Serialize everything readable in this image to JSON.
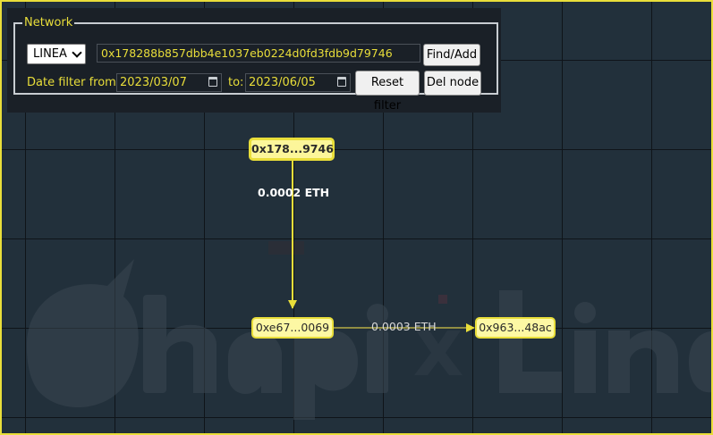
{
  "network": {
    "legend": "Network",
    "chain_selected": "LINEA",
    "address_value": "0x178288b857dbb4e1037eb0224d0fd3fdb9d79746",
    "find_add_label": "Find/Add",
    "date_filter_from_label": "Date filter from:",
    "date_from": "2023/03/07",
    "to_label": "to:",
    "date_to": "2023/06/05",
    "reset_filter_label": "Reset filter",
    "del_node_label": "Del node"
  },
  "graph": {
    "nodes": [
      {
        "id": "root",
        "label": "0x178...9746"
      },
      {
        "id": "mid",
        "label": "0xe67...0069"
      },
      {
        "id": "right",
        "label": "0x963...48ac"
      }
    ],
    "edges": [
      {
        "label": "0.0002 ETH"
      },
      {
        "label": "0.0003 ETH"
      }
    ]
  },
  "colors": {
    "accent": "#e9de3a",
    "background": "#22303b",
    "node_fill": "#fdf8a4"
  }
}
